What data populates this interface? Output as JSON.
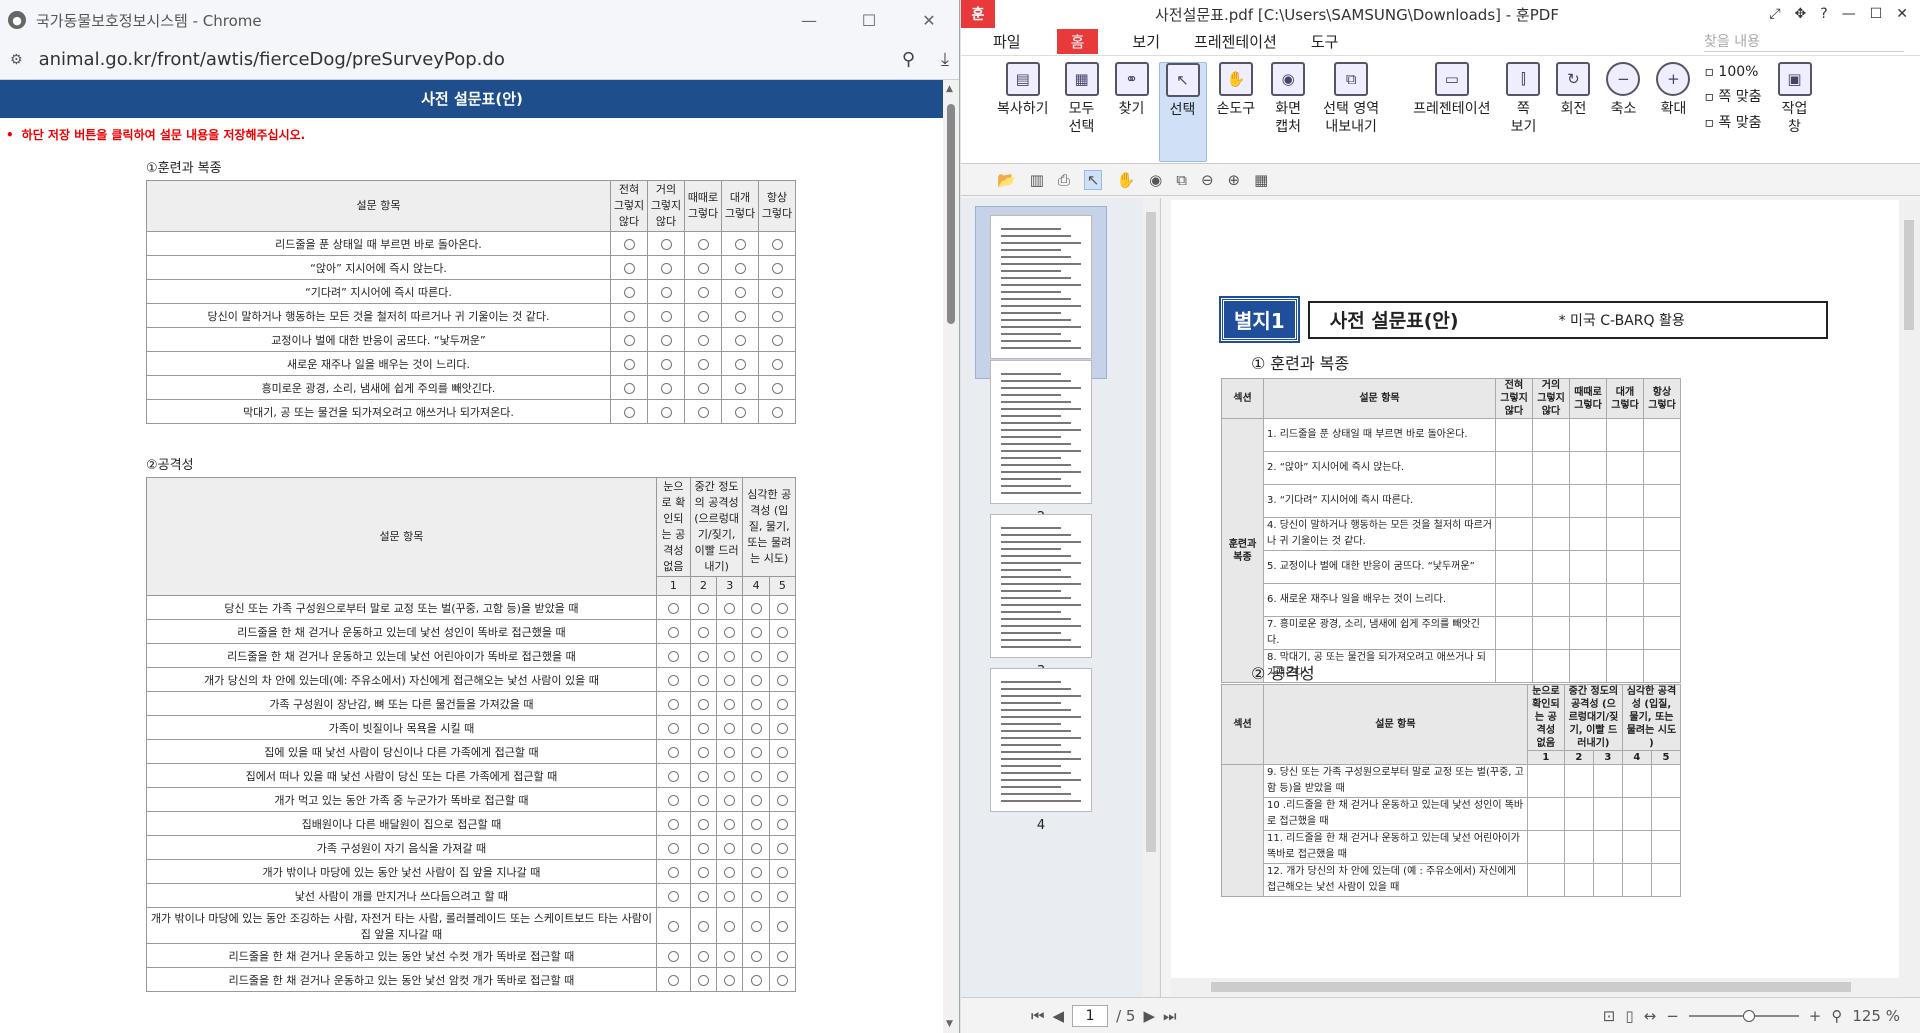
{
  "chrome": {
    "window_title": "국가동물보호정보시스템 - Chrome",
    "url": "animal.go.kr/front/awtis/fierceDog/preSurveyPop.do",
    "popup_title": "사전 설문표(안)",
    "notice": "하단 저장 버튼을 클릭하여 설문 내용을 저장해주십시오.",
    "section1": {
      "title": "①훈련과 복종",
      "item_header": "설문 항목",
      "cols": [
        "전혀 그렇지 않다",
        "거의 그렇지 않다",
        "때때로 그렇다",
        "대개 그렇다",
        "항상 그렇다"
      ],
      "items": [
        "리드줄을 푼 상태일 때 부르면 바로 돌아온다.",
        "“앉아” 지시어에 즉시 앉는다.",
        "“기다려” 지시어에 즉시 따른다.",
        "당신이 말하거나 행동하는 모든 것을 철저히 따르거나 귀 기울이는 것 같다.",
        "교정이나 벌에 대한 반응이 굼뜨다. “낯두꺼운”",
        "새로운 재주나 일을 배우는 것이 느리다.",
        "흥미로운 광경, 소리, 냄새에 쉽게 주의를 빼앗긴다.",
        "막대기, 공 또는 물건을 되가져오려고 애쓰거나 되가져온다."
      ]
    },
    "section2": {
      "title": "②공격성",
      "item_header": "설문 항목",
      "cols": [
        "눈으로 확인되는 공격성 없음",
        "중간 정도의 공격성 (으르렁대기/짖기, 이빨 드러내기)",
        "심각한 공격성 (입질, 물기, 또는 물려는 시도)"
      ],
      "scale": [
        "1",
        "2",
        "3",
        "4",
        "5"
      ],
      "items": [
        "당신 또는 가족 구성원으로부터 말로 교정 또는 벌(꾸중, 고함 등)을 받았을 때",
        "리드줄을 한 채 걷거나 운동하고 있는데 낯선 성인이 똑바로 접근했을 때",
        "리드줄을 한 채 걷거나 운동하고 있는데 낯선 어린아이가 똑바로 접근했을 때",
        "개가 당신의 차 안에 있는데(예: 주유소에서) 자신에게 접근해오는 낯선 사람이 있을 때",
        "가족 구성원이 장난감, 뼈 또는 다른 물건들을 가져갔을 때",
        "가족이 빗질이나 목욕을 시킬 때",
        "집에 있을 때 낯선 사람이 당신이나 다른 가족에게 접근할 때",
        "집에서 떠나 있을 때 낯선 사람이 당신 또는 다른 가족에게 접근할 때",
        "개가 먹고 있는 동안 가족 중 누군가가 똑바로 접근할 때",
        "집배원이나 다른 배달원이 집으로 접근할 때",
        "가족 구성원이 자기 음식을 가져갈 때",
        "개가 밖이나 마당에 있는 동안 낯선 사람이 집 앞을 지나갈 때",
        "낯선 사람이 개를 만지거나 쓰다듬으려고 할 때",
        "개가 밖이나 마당에 있는 동안 조깅하는 사람, 자전거 타는 사람, 롤러블레이드 또는 스케이트보드 타는 사람이 집 앞을 지나갈 때",
        "리드줄을 한 채 걷거나 운동하고 있는 동안 낯선 수컷 개가 똑바로 접근할 때",
        "리드줄을 한 채 걷거나 운동하고 있는 동안 낯선 암컷 개가 똑바로 접근할 때"
      ]
    }
  },
  "hpdf": {
    "title": "사전설문표.pdf [C:\\Users\\SAMSUNG\\Downloads] - 훈PDF",
    "menu": {
      "file": "파일",
      "home": "홈",
      "view": "보기",
      "present": "프레젠테이션",
      "tools": "도구",
      "search_placeholder": "찾을 내용"
    },
    "ribbon": [
      "복사하기",
      "모두 선택",
      "찾기",
      "선택",
      "손도구",
      "화면 캡처",
      "선택 영역 내보내기",
      "프레젠테이션",
      "쪽 보기",
      "회전",
      "축소",
      "확대",
      "작업 창"
    ],
    "zoom_opts": [
      "100%",
      "쪽 맞춤",
      "폭 맞춤"
    ],
    "thumbs": [
      "1",
      "2",
      "3",
      "4"
    ],
    "page_current": "1",
    "page_total": "/ 5",
    "zoom": "125 %",
    "doc": {
      "tag": "별지1",
      "title": "사전 설문표(안)",
      "note": "* 미국 C-BARQ 활용",
      "sec1": "① 훈련과 복종",
      "sec2": "② 공격성",
      "col_section": "섹션",
      "col_item": "설문 항목",
      "sec1_label": "훈련과 복종",
      "sec1_cols": [
        "전혀 그렇지 않다",
        "거의 그렇지 않다",
        "때때로 그렇다",
        "대개 그렇다",
        "항상 그렇다"
      ],
      "sec1_items": [
        "1. 리드줄을 푼 상태일 때 부르면 바로 돌아온다.",
        "2. “앉아” 지시어에 즉시 앉는다.",
        "3. “기다려” 지시어에 즉시 따른다.",
        "4. 당신이 말하거나 행동하는 모든 것을 철저히 따르거나 귀 기울이는 것 같다.",
        "5. 교정이나 벌에 대한 반응이 굼뜨다. “낯두꺼운”",
        "6. 새로운 재주나 일을 배우는 것이 느리다.",
        "7. 흥미로운 광경, 소리, 냄새에 쉽게 주의를 빼앗긴다.",
        "8. 막대기, 공 또는 물건을 되가져오려고 애쓰거나 되가져온다."
      ],
      "sec2_cols": [
        "눈으로 확인되는 공격성 없음",
        "중간 정도의 공격성 (으르렁대기/짖기, 이빨 드러내기)",
        "심각한 공격성 (입질, 물기, 또는 물려는 시도 )"
      ],
      "sec2_items": [
        "9. 당신 또는 가족 구성원으로부터 말로 교정 또는 벌(꾸중, 고함 등)을 받았을 때",
        "10 .리드줄을 한 채 걷거나 운동하고 있는데 낯선 성인이 똑바로 접근했을 때",
        "11. 리드줄을 한 채 걷거나 운동하고 있는데 낯선 어린아이가 똑바로 접근했을 때",
        "12. 개가 당신의 차 안에 있는데 (예 : 주유소에서) 자신에게 접근해오는 낯선 사람이 있을 때"
      ]
    }
  }
}
